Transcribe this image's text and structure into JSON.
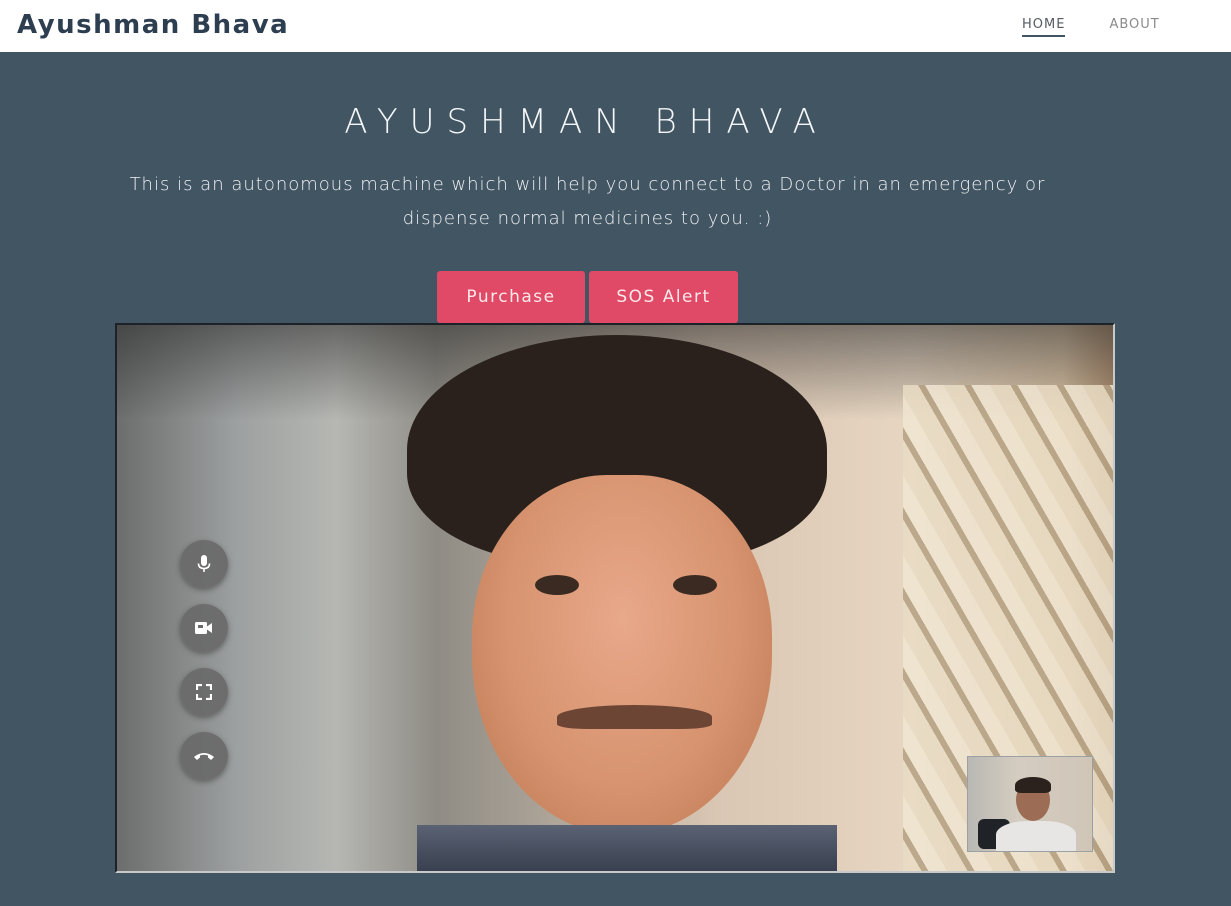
{
  "brand": "Ayushman Bhava",
  "nav": {
    "items": [
      {
        "label": "HOME",
        "active": true
      },
      {
        "label": "ABOUT",
        "active": false
      }
    ]
  },
  "hero": {
    "title": "AYUSHMAN BHAVA",
    "description": "This is an autonomous machine which will help you connect to a Doctor in an emergency or dispense normal medicines to you. :)"
  },
  "actions": {
    "purchase_label": "Purchase",
    "sos_label": "SOS Alert"
  },
  "video_call": {
    "controls": [
      {
        "icon": "microphone-icon"
      },
      {
        "icon": "video-camera-icon"
      },
      {
        "icon": "fullscreen-icon"
      },
      {
        "icon": "hang-up-icon"
      }
    ]
  },
  "colors": {
    "background": "#425563",
    "accent": "#e04a66",
    "navbar": "#ffffff",
    "brand_text": "#2c3e50"
  }
}
